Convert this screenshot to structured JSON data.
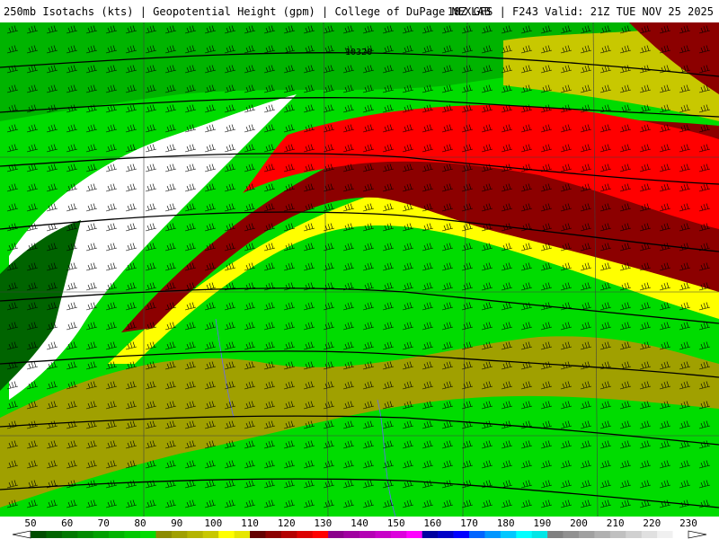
{
  "header": {
    "left_text": "250mb Isotachs (kts) | Geopotential Height (gpm) | College of DuPage NEXLAB",
    "right_text": "18Z GFS | F243 Valid: 21Z TUE NOV 25 2025"
  },
  "map": {
    "contour_label": "10320",
    "colors": {
      "lt50": "#ffffff",
      "c50": "#006400",
      "c60": "#008c00",
      "c70": "#00b400",
      "c80": "#00dc00",
      "c90": "#a0a000",
      "c100": "#c8c800",
      "c110": "#ffff00",
      "c120": "#8c0000",
      "c130": "#dc0000",
      "c140": "#ff0000",
      "height_contour": "#000000",
      "barb": "#000000",
      "border": "#404040",
      "river": "#6666ff"
    }
  },
  "colorbar": {
    "ticks": [
      "50",
      "60",
      "70",
      "80",
      "90",
      "100",
      "110",
      "120",
      "130",
      "140",
      "150",
      "160",
      "170",
      "180",
      "190",
      "200",
      "210",
      "220",
      "230"
    ],
    "swatches": [
      "#004d00",
      "#006400",
      "#007800",
      "#008c00",
      "#00a000",
      "#00b400",
      "#00c800",
      "#00dc00",
      "#8c8c00",
      "#a0a000",
      "#b4b400",
      "#c8c800",
      "#ffff00",
      "#e6e600",
      "#640000",
      "#8c0000",
      "#b40000",
      "#dc0000",
      "#ff0000",
      "#8c008c",
      "#a000a0",
      "#b400b4",
      "#c800c8",
      "#dc00dc",
      "#ff00ff",
      "#0000a0",
      "#0000c8",
      "#0000ff",
      "#0064ff",
      "#0096ff",
      "#00c8ff",
      "#00ffff",
      "#00e6e6",
      "#808080",
      "#909090",
      "#a0a0a0",
      "#b0b0b0",
      "#c0c0c0",
      "#d0d0d0",
      "#e0e0e0",
      "#f0f0f0",
      "#ffffff"
    ]
  }
}
